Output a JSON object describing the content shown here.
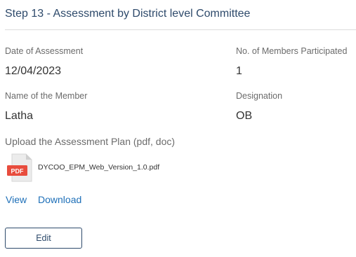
{
  "section": {
    "title": "Step 13 - Assessment by District level Committee"
  },
  "fields": {
    "date_of_assessment": {
      "label": "Date of Assessment",
      "value": "12/04/2023"
    },
    "members_participated": {
      "label": "No. of Members Participated",
      "value": "1"
    },
    "member_name": {
      "label": "Name of the Member",
      "value": "Latha"
    },
    "designation": {
      "label": "Designation",
      "value": "OB"
    }
  },
  "upload": {
    "label": "Upload the Assessment Plan (pdf, doc)",
    "file_type_badge": "PDF",
    "file_name": "DYCOO_EPM_Web_Version_1.0.pdf",
    "file_icon": "pdf-file-icon",
    "view_label": "View",
    "download_label": "Download"
  },
  "actions": {
    "edit_label": "Edit"
  },
  "colors": {
    "title": "#2e4a6b",
    "link": "#1d6fb8",
    "pdf_badge": "#e84c3d"
  }
}
